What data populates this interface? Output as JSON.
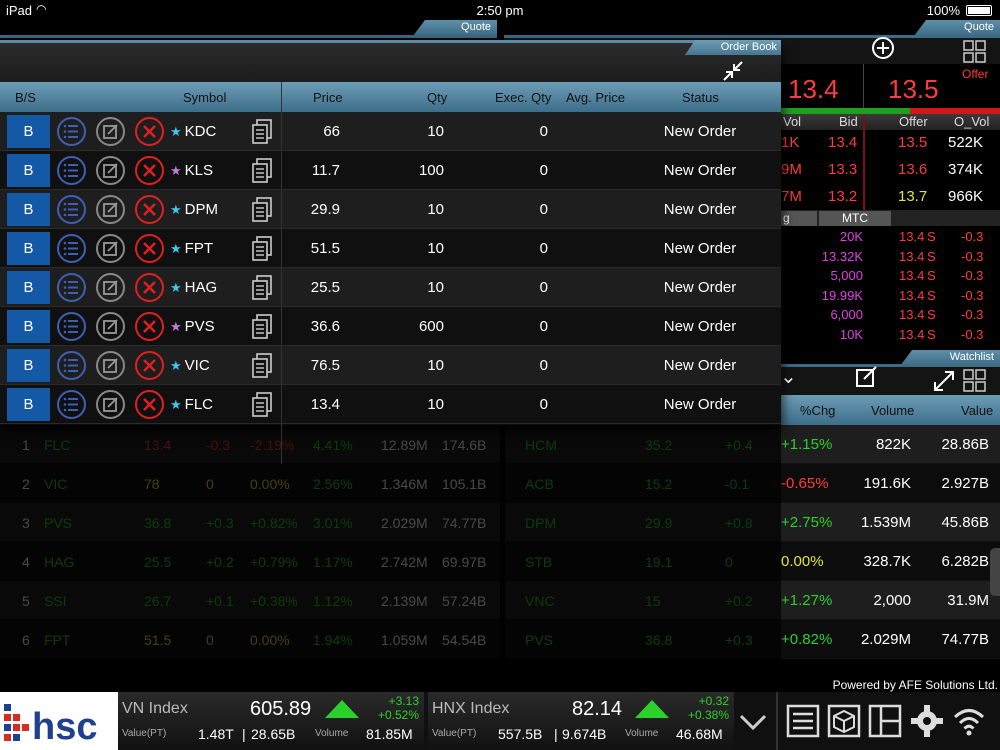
{
  "status_bar": {
    "device": "iPad",
    "time": "2:50 pm",
    "battery": "100%"
  },
  "left_quote_tab": "Quote",
  "right_quote_tab": "Quote",
  "order_book": {
    "tab_label": "Order Book",
    "columns": [
      "B/S",
      "Symbol",
      "Price",
      "Qty",
      "Exec. Qty",
      "Avg. Price",
      "Status"
    ],
    "rows": [
      {
        "side": "B",
        "symbol": "KDC",
        "star": "blue",
        "price": "66",
        "qty": "10",
        "exec": "0",
        "status": "New Order"
      },
      {
        "side": "B",
        "symbol": "KLS",
        "star": "purple",
        "price": "11.7",
        "qty": "100",
        "exec": "0",
        "status": "New Order"
      },
      {
        "side": "B",
        "symbol": "DPM",
        "star": "blue",
        "price": "29.9",
        "qty": "10",
        "exec": "0",
        "status": "New Order"
      },
      {
        "side": "B",
        "symbol": "FPT",
        "star": "blue",
        "price": "51.5",
        "qty": "10",
        "exec": "0",
        "status": "New Order"
      },
      {
        "side": "B",
        "symbol": "HAG",
        "star": "blue",
        "price": "25.5",
        "qty": "10",
        "exec": "0",
        "status": "New Order"
      },
      {
        "side": "B",
        "symbol": "PVS",
        "star": "purple",
        "price": "36.6",
        "qty": "600",
        "exec": "0",
        "status": "New Order"
      },
      {
        "side": "B",
        "symbol": "VIC",
        "star": "blue",
        "price": "76.5",
        "qty": "10",
        "exec": "0",
        "status": "New Order"
      },
      {
        "side": "B",
        "symbol": "FLC",
        "star": "blue",
        "price": "13.4",
        "qty": "10",
        "exec": "0",
        "status": "New Order"
      }
    ]
  },
  "quote_panel": {
    "bid_price": "13.4",
    "offer_price": "13.5",
    "offer_label": "Offer",
    "headers": {
      "vol": "Vol",
      "bid": "Bid",
      "offer": "Offer",
      "o_vol": "O_Vol"
    },
    "depth": [
      {
        "vol": "1K",
        "bid": "13.4",
        "offer": "13.5",
        "o_vol": "522K"
      },
      {
        "vol": "9M",
        "bid": "13.3",
        "offer": "13.6",
        "o_vol": "374K"
      },
      {
        "vol": "7M",
        "bid": "13.2",
        "offer": "13.7",
        "o_vol": "966K"
      }
    ],
    "tabs": [
      "g",
      "MTC"
    ],
    "trades": [
      {
        "vol": "20K",
        "price": "13.4",
        "side": "S",
        "chg": "-0.3"
      },
      {
        "vol": "13.32K",
        "price": "13.4",
        "side": "S",
        "chg": "-0.3"
      },
      {
        "vol": "5,000",
        "price": "13.4",
        "side": "S",
        "chg": "-0.3"
      },
      {
        "vol": "19.99K",
        "price": "13.4",
        "side": "S",
        "chg": "-0.3"
      },
      {
        "vol": "6,000",
        "price": "13.4",
        "side": "S",
        "chg": "-0.3"
      },
      {
        "vol": "10K",
        "price": "13.4",
        "side": "S",
        "chg": "-0.3"
      }
    ]
  },
  "watchlist": {
    "tab_label": "Watchlist",
    "headers": {
      "chg": "%Chg",
      "volume": "Volume",
      "value": "Value"
    },
    "rows": [
      {
        "chg": "+1.15%",
        "volume": "822K",
        "value": "28.86B",
        "color": "#2bd12b"
      },
      {
        "chg": "-0.65%",
        "volume": "191.6K",
        "value": "2.927B",
        "color": "#ff3b3b"
      },
      {
        "chg": "+2.75%",
        "volume": "1.539M",
        "value": "45.86B",
        "color": "#2bd12b"
      },
      {
        "chg": "0.00%",
        "volume": "328.7K",
        "value": "6.282B",
        "color": "#e8e33a"
      },
      {
        "chg": "+1.27%",
        "volume": "2,000",
        "value": "31.9M",
        "color": "#2bd12b"
      },
      {
        "chg": "+0.82%",
        "volume": "2.029M",
        "value": "74.77B",
        "color": "#2bd12b"
      }
    ]
  },
  "bg_left_rows": [
    {
      "n": "1",
      "sym": "FLC",
      "a": "13.4",
      "b": "-0.3",
      "c": "-2.19%",
      "d": "4.41%",
      "e": "12.89M",
      "f": "174.6B"
    },
    {
      "n": "2",
      "sym": "VIC",
      "a": "78",
      "b": "0",
      "c": "0.00%",
      "d": "2.56%",
      "e": "1.346M",
      "f": "105.1B"
    },
    {
      "n": "3",
      "sym": "PVS",
      "a": "36.8",
      "b": "+0.3",
      "c": "+0.82%",
      "d": "3.01%",
      "e": "2.029M",
      "f": "74.77B"
    },
    {
      "n": "4",
      "sym": "HAG",
      "a": "25.5",
      "b": "+0.2",
      "c": "+0.79%",
      "d": "1.17%",
      "e": "2.742M",
      "f": "69.97B"
    },
    {
      "n": "5",
      "sym": "SSI",
      "a": "26.7",
      "b": "+0.1",
      "c": "+0.38%",
      "d": "1.12%",
      "e": "2.139M",
      "f": "57.24B"
    },
    {
      "n": "6",
      "sym": "FPT",
      "a": "51.5",
      "b": "0",
      "c": "0.00%",
      "d": "1.94%",
      "e": "1.059M",
      "f": "54.54B"
    }
  ],
  "bg_mid_rows": [
    {
      "sym": "HCM",
      "a": "35.2",
      "b": "+0.4"
    },
    {
      "sym": "ACB",
      "a": "15.2",
      "b": "-0.1"
    },
    {
      "sym": "DPM",
      "a": "29.9",
      "b": "+0.8"
    },
    {
      "sym": "STB",
      "a": "19.1",
      "b": "0"
    },
    {
      "sym": "VNC",
      "a": "15",
      "b": "+0.2"
    },
    {
      "sym": "PVS",
      "a": "36.8",
      "b": "+0.3"
    }
  ],
  "footer": {
    "powered_by": "Powered by AFE Solutions Ltd.",
    "logo_text": "hsc",
    "vn": {
      "name": "VN Index",
      "value": "605.89",
      "chg": "+3.13",
      "pct": "+0.52%",
      "value_label": "Value(PT)",
      "v1": "1.48T",
      "v2": "28.65B",
      "vol_label": "Volume",
      "vol": "81.85M"
    },
    "hnx": {
      "name": "HNX Index",
      "value": "82.14",
      "chg": "+0.32",
      "pct": "+0.38%",
      "value_label": "Value(PT)",
      "v1": "557.5B",
      "v2": "9.674B",
      "vol_label": "Volume",
      "vol": "46.68M"
    }
  }
}
